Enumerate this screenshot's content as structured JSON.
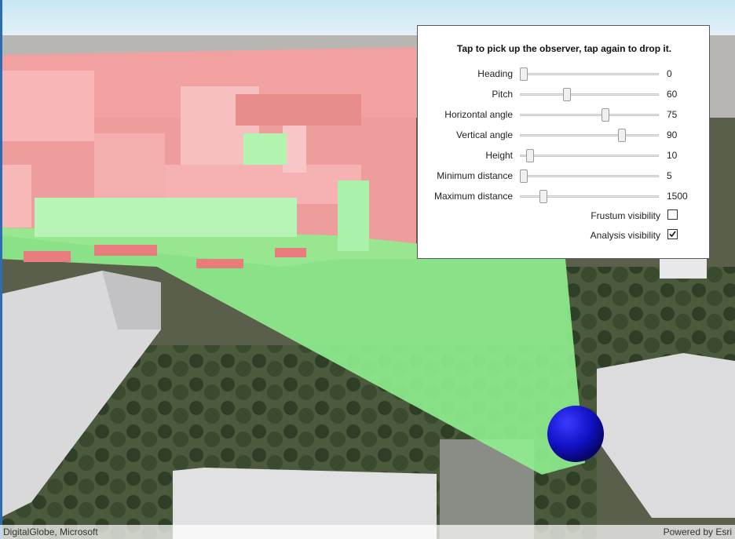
{
  "panel": {
    "title": "Tap to pick up the observer, tap again to drop it.",
    "sliders": [
      {
        "label": "Heading",
        "value": "0",
        "fraction": 0.0
      },
      {
        "label": "Pitch",
        "value": "60",
        "fraction": 0.33
      },
      {
        "label": "Horizontal angle",
        "value": "75",
        "fraction": 0.62
      },
      {
        "label": "Vertical angle",
        "value": "90",
        "fraction": 0.75
      },
      {
        "label": "Height",
        "value": "10",
        "fraction": 0.05
      },
      {
        "label": "Minimum distance",
        "value": "5",
        "fraction": 0.0
      },
      {
        "label": "Maximum distance",
        "value": "1500",
        "fraction": 0.15
      }
    ],
    "checkboxes": [
      {
        "label": "Frustum visibility",
        "checked": false
      },
      {
        "label": "Analysis visibility",
        "checked": true
      }
    ]
  },
  "attribution": {
    "left": "DigitalGlobe, Microsoft",
    "right": "Powered by Esri"
  },
  "colors": {
    "visible": "#8ff08f",
    "obstructed": "#f4a0a0",
    "observer": "#1a1ad0",
    "sky": "#d6ecf5"
  }
}
